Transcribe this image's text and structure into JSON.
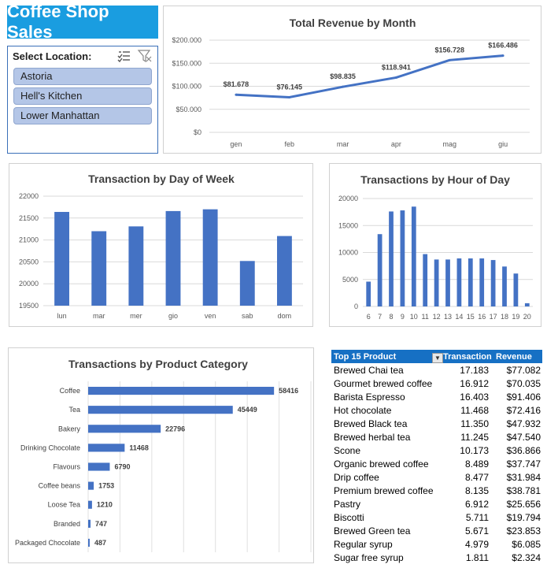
{
  "dashboard": {
    "title": "Coffee Shop Sales"
  },
  "slicer": {
    "title": "Select Location:",
    "multiselect_icon": "multi-select-icon",
    "clear_filter_icon": "clear-filter-icon",
    "items": [
      "Astoria",
      "Hell's Kitchen",
      "Lower Manhattan"
    ]
  },
  "colors": {
    "accent": "#1a9de0",
    "series": "#4472c4",
    "table_header": "#1670c4",
    "slicer_item": "#b4c6e7"
  },
  "chart_data": [
    {
      "id": "revenue",
      "type": "line",
      "title": "Total Revenue by Month",
      "categories": [
        "gen",
        "feb",
        "mar",
        "apr",
        "mag",
        "giu"
      ],
      "values": [
        81678,
        76145,
        98835,
        118941,
        156728,
        166486
      ],
      "labels": [
        "$81.678",
        "$76.145",
        "$98.835",
        "$118.941",
        "$156.728",
        "$166.486"
      ],
      "ylim": [
        0,
        200000
      ],
      "yticks": [
        0,
        50000,
        100000,
        150000,
        200000
      ],
      "ytick_labels": [
        "$0",
        "$50.000",
        "$100.000",
        "$150.000",
        "$200.000"
      ],
      "grid": true
    },
    {
      "id": "weekday",
      "type": "bar",
      "title": "Transaction by Day of Week",
      "categories": [
        "lun",
        "mar",
        "mer",
        "gio",
        "ven",
        "sab",
        "dom"
      ],
      "values": [
        21640,
        21200,
        21310,
        21660,
        21700,
        20520,
        21090
      ],
      "ylim": [
        19500,
        22000
      ],
      "yticks": [
        19500,
        20000,
        20500,
        21000,
        21500,
        22000
      ],
      "ytick_labels": [
        "19500",
        "20000",
        "20500",
        "21000",
        "21500",
        "22000"
      ],
      "grid": true
    },
    {
      "id": "hour",
      "type": "bar",
      "title": "Transactions by Hour of Day",
      "categories": [
        "6",
        "7",
        "8",
        "9",
        "10",
        "11",
        "12",
        "13",
        "14",
        "15",
        "16",
        "17",
        "18",
        "19",
        "20"
      ],
      "values": [
        4600,
        13400,
        17600,
        17800,
        18500,
        9700,
        8700,
        8700,
        8900,
        8900,
        8900,
        8600,
        7400,
        6100,
        600
      ],
      "ylim": [
        0,
        20000
      ],
      "yticks": [
        0,
        5000,
        10000,
        15000,
        20000
      ],
      "ytick_labels": [
        "0",
        "5000",
        "10000",
        "15000",
        "20000"
      ],
      "grid": true
    },
    {
      "id": "category",
      "type": "bar",
      "orientation": "horizontal",
      "title": "Transactions by Product Category",
      "categories": [
        "Coffee",
        "Tea",
        "Bakery",
        "Drinking Chocolate",
        "Flavours",
        "Coffee beans",
        "Loose Tea",
        "Branded",
        "Packaged Chocolate"
      ],
      "values": [
        58416,
        45449,
        22796,
        11468,
        6790,
        1753,
        1210,
        747,
        487
      ],
      "labels": [
        "58416",
        "45449",
        "22796",
        "11468",
        "6790",
        "1753",
        "1210",
        "747",
        "487"
      ],
      "xlim": [
        0,
        70000
      ],
      "grid": true
    },
    {
      "id": "top15",
      "type": "table",
      "columns": [
        "Top 15 Product",
        "Transaction",
        "Revenue"
      ],
      "filter_icon": "sort-filter-icon",
      "rows": [
        [
          "Brewed Chai tea",
          "17.183",
          "$77.082"
        ],
        [
          "Gourmet brewed coffee",
          "16.912",
          "$70.035"
        ],
        [
          "Barista Espresso",
          "16.403",
          "$91.406"
        ],
        [
          "Hot chocolate",
          "11.468",
          "$72.416"
        ],
        [
          "Brewed Black tea",
          "11.350",
          "$47.932"
        ],
        [
          "Brewed herbal tea",
          "11.245",
          "$47.540"
        ],
        [
          "Scone",
          "10.173",
          "$36.866"
        ],
        [
          "Organic brewed coffee",
          "8.489",
          "$37.747"
        ],
        [
          "Drip coffee",
          "8.477",
          "$31.984"
        ],
        [
          "Premium brewed coffee",
          "8.135",
          "$38.781"
        ],
        [
          "Pastry",
          "6.912",
          "$25.656"
        ],
        [
          "Biscotti",
          "5.711",
          "$19.794"
        ],
        [
          "Brewed Green tea",
          "5.671",
          "$23.853"
        ],
        [
          "Regular syrup",
          "4.979",
          "$6.085"
        ],
        [
          "Sugar free syrup",
          "1.811",
          "$2.324"
        ]
      ]
    }
  ]
}
